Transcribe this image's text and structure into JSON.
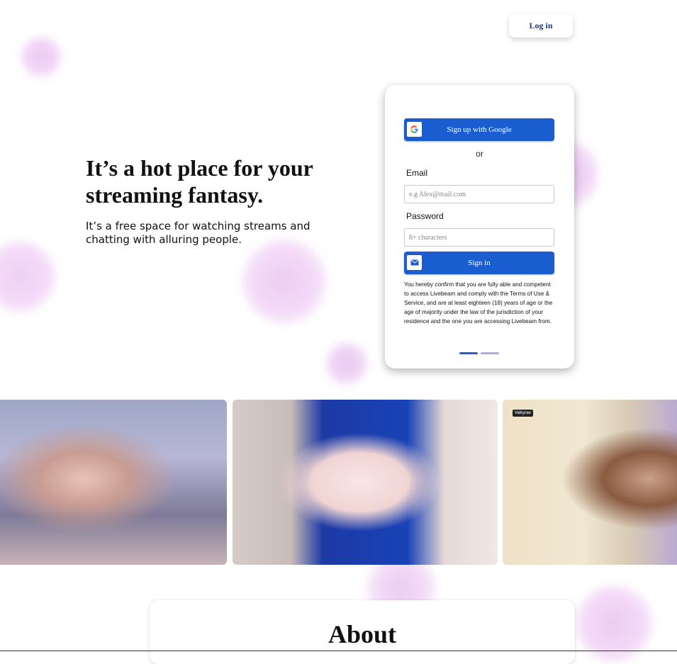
{
  "header": {
    "login_label": "Log in"
  },
  "hero": {
    "title": "It’s a hot place for your streaming fantasy.",
    "subtitle": "It’s a free space for watching streams and chatting with alluring people."
  },
  "signup_card": {
    "google_button_label": "Sign up with Google",
    "or_label": "or",
    "email_label": "Email",
    "email_placeholder": "e.g Alex@mail.com",
    "password_label": "Password",
    "password_placeholder": "8+ characters",
    "signin_button_label": "Sign in",
    "terms_text": "You hereby confirm that you are fully able and competent to access Livebeam and comply with the Terms of Use & Service, and are at least eighteen (18) years of age or the age of majority under the law of the jurisdiction of your residence and the one you are accessing Livebeam from.",
    "pager": {
      "count": 2,
      "active_index": 0
    }
  },
  "streams": [
    {
      "name": "stream-thumbnail-1"
    },
    {
      "name": "stream-thumbnail-2"
    },
    {
      "name": "stream-thumbnail-3",
      "tag": "Valkyrae"
    }
  ],
  "about": {
    "title": "About"
  },
  "colors": {
    "primary_button": "#1a5dd1",
    "accent_blob": "#e0a2ec",
    "login_text": "#1f3a8a",
    "pager_active": "#2a5bd4",
    "pager_inactive": "#b9a6e6"
  },
  "icons": {
    "google": "google-logo-icon",
    "mail": "envelope-icon"
  }
}
